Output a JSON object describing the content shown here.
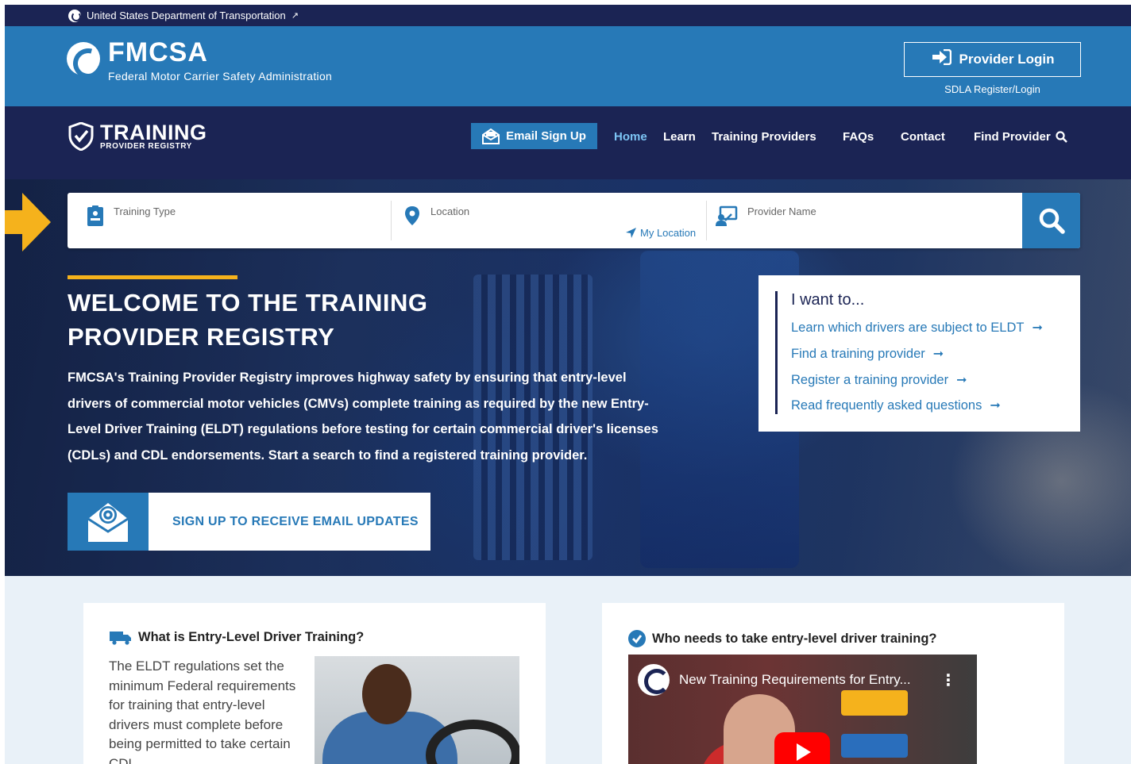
{
  "gov_bar": {
    "text": "United States Department of Transportation",
    "ext_icon": "↗"
  },
  "header": {
    "title": "FMCSA",
    "subtitle": "Federal Motor Carrier Safety Administration",
    "provider_login": "Provider Login",
    "sdla": "SDLA Register/Login"
  },
  "nav": {
    "logo_big": "TRAINING",
    "logo_small": "PROVIDER REGISTRY",
    "email_signup": "Email Sign Up",
    "links": [
      "Home",
      "Learn",
      "Training Providers",
      "FAQs",
      "Contact",
      "Find Provider"
    ],
    "active": "Home"
  },
  "search": {
    "training_type": "Training Type",
    "location": "Location",
    "my_location": "My Location",
    "provider_name": "Provider Name"
  },
  "hero": {
    "title": "WELCOME TO THE TRAINING PROVIDER REGISTRY",
    "description": "FMCSA's Training Provider Registry improves highway safety by ensuring that entry-level drivers of commercial motor vehicles (CMVs) complete training as required by the new Entry-Level Driver Training (ELDT) regulations before testing for certain commercial driver's licenses (CDLs) and CDL endorsements. Start a search to find a registered training provider.",
    "signup": "SIGN UP TO RECEIVE EMAIL UPDATES"
  },
  "iwant": {
    "title": "I want to...",
    "items": [
      "Learn which drivers are subject to ELDT",
      "Find a training provider",
      "Register a training provider",
      "Read frequently asked questions"
    ]
  },
  "cards": {
    "card1_title": "What is Entry-Level Driver Training?",
    "card1_text": "The ELDT regulations set the minimum Federal requirements for training that entry-level drivers must complete before being permitted to take certain CDL",
    "card2_title": "Who needs to take entry-level driver training?",
    "video_title": "New Training Requirements for Entry...",
    "video_menu": "⋮"
  },
  "colors": {
    "navy": "#1b2454",
    "blue": "#2779b7",
    "accent": "#f5b21c",
    "light_blue": "#7cc4f4"
  }
}
